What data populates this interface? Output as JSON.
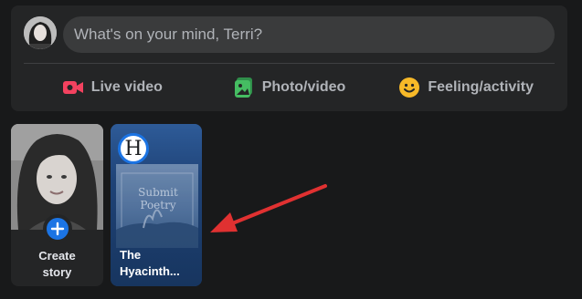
{
  "composer": {
    "placeholder": "What's on your mind, Terri?",
    "actions": [
      {
        "label": "Live video",
        "icon": "live-video-icon",
        "color": "#f3425f"
      },
      {
        "label": "Photo/video",
        "icon": "photo-video-icon",
        "color": "#45bd62"
      },
      {
        "label": "Feeling/activity",
        "icon": "feeling-activity-icon",
        "color": "#f7b928"
      }
    ]
  },
  "stories": {
    "create": {
      "label": "Create\nstory",
      "icon": "plus-icon",
      "accent": "#1b74e4"
    },
    "page_story": {
      "name": "The\nHyacinth...",
      "avatar_letter": "H",
      "poster_text": "Submit\nPoetry"
    }
  },
  "annotation": {
    "arrow_color": "#e03131"
  }
}
